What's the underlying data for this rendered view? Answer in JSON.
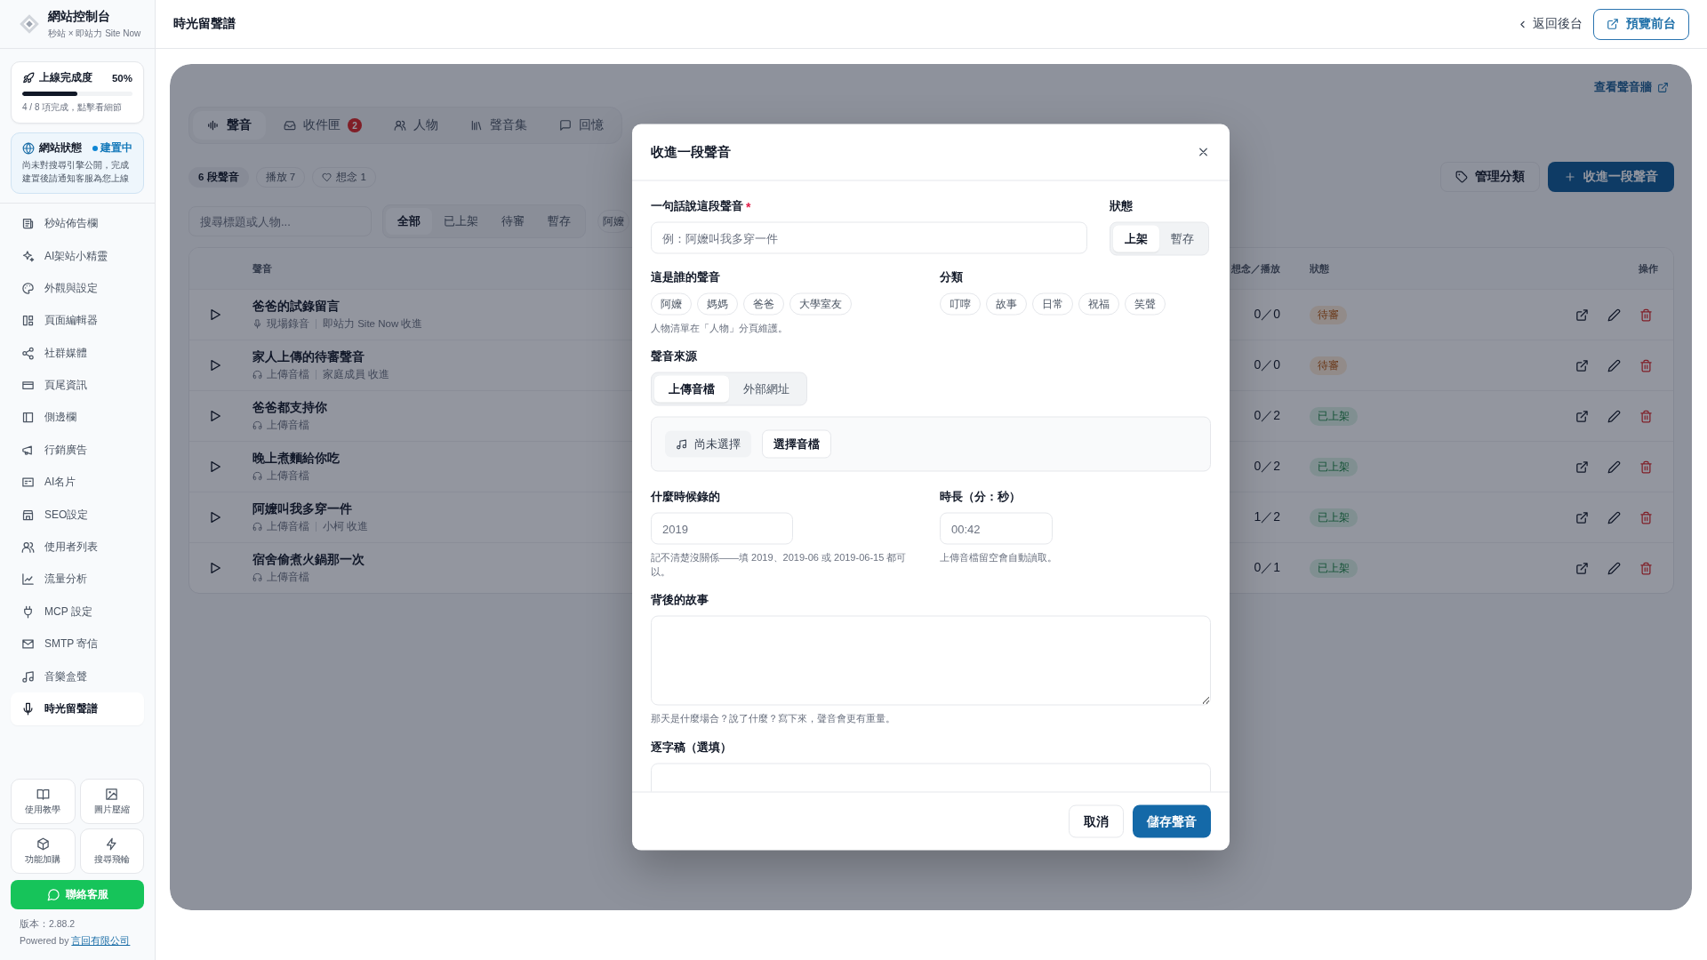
{
  "sidebar": {
    "brand": {
      "title": "網站控制台",
      "subtitle": "秒站 × 即站力 Site Now"
    },
    "progress_card": {
      "title": "上線完成度",
      "percent": "50%",
      "level": 0.5,
      "caption": "4 / 8 項完成，點擊看細節"
    },
    "status_card": {
      "title": "網站狀態",
      "status": "建置中",
      "description": "尚未對搜尋引擎公開，完成建置後請通知客服為您上線"
    },
    "items": [
      {
        "label": "秒站佈告欄",
        "selected": false
      },
      {
        "label": "AI架站小精靈",
        "selected": false
      },
      {
        "label": "外觀與設定",
        "selected": false
      },
      {
        "label": "頁面編輯器",
        "selected": false
      },
      {
        "label": "社群媒體",
        "selected": false
      },
      {
        "label": "頁尾資訊",
        "selected": false
      },
      {
        "label": "側邊欄",
        "selected": false
      },
      {
        "label": "行銷廣告",
        "selected": false
      },
      {
        "label": "AI名片",
        "selected": false
      },
      {
        "label": "SEO設定",
        "selected": false
      },
      {
        "label": "使用者列表",
        "selected": false
      },
      {
        "label": "流量分析",
        "selected": false
      },
      {
        "label": "MCP 設定",
        "selected": false
      },
      {
        "label": "SMTP 寄信",
        "selected": false
      },
      {
        "label": "音樂盒聲",
        "selected": false
      },
      {
        "label": "時光留聲譜",
        "selected": true
      }
    ],
    "tools": [
      {
        "label": "使用教學"
      },
      {
        "label": "圖片壓縮"
      },
      {
        "label": "功能加購"
      },
      {
        "label": "搜尋飛輪"
      }
    ],
    "contact_button": "聯絡客服",
    "version": "版本：2.88.2",
    "powered_by": {
      "text": "Powered by",
      "link": "言回有限公司"
    }
  },
  "header": {
    "title": "時光留聲譜",
    "back_link": "返回後台",
    "preview_button": "預覽前台"
  },
  "page": {
    "wall_link": "查看聲音牆",
    "tabs": [
      {
        "label": "聲音",
        "selected": true
      },
      {
        "label": "收件匣",
        "badge": "2",
        "selected": false
      },
      {
        "label": "人物",
        "selected": false
      },
      {
        "label": "聲音集",
        "selected": false
      },
      {
        "label": "回憶",
        "selected": false
      }
    ],
    "total": "6 段聲音",
    "plays": "播放 7",
    "likes": "想念 1",
    "manage_button": "管理分類",
    "add_button": "收進一段聲音",
    "search": {
      "placeholder": "搜尋標題或人物..."
    },
    "filters": [
      {
        "label": "全部",
        "selected": true
      },
      {
        "label": "已上架",
        "selected": false
      },
      {
        "label": "待審",
        "selected": false
      },
      {
        "label": "暫存",
        "selected": false
      }
    ],
    "person_filter": "阿嬤",
    "table": {
      "columns": {
        "title": "聲音",
        "counts": "想念／播放",
        "status": "狀態",
        "actions": "操作"
      },
      "rows": [
        {
          "title": "爸爸的試錄留言",
          "kind": "live",
          "source": "現場錄音",
          "contributor": "即站力 Site Now 收進",
          "counts": "0／0",
          "status": {
            "label": "待審",
            "kind": "pending"
          }
        },
        {
          "title": "家人上傳的待審聲音",
          "kind": "upload",
          "source": "上傳音檔",
          "contributor": "家庭成員 收進",
          "counts": "0／0",
          "status": {
            "label": "待審",
            "kind": "pending"
          }
        },
        {
          "title": "爸爸都支持你",
          "kind": "upload",
          "source": "上傳音檔",
          "counts": "0／2",
          "status": {
            "label": "已上架",
            "kind": "published"
          }
        },
        {
          "title": "晚上煮麵給你吃",
          "kind": "upload",
          "source": "上傳音檔",
          "counts": "0／2",
          "status": {
            "label": "已上架",
            "kind": "published"
          }
        },
        {
          "title": "阿嬤叫我多穿一件",
          "kind": "upload",
          "source": "上傳音檔",
          "contributor": "小柯 收進",
          "counts": "1／2",
          "status": {
            "label": "已上架",
            "kind": "published"
          }
        },
        {
          "title": "宿舍偷煮火鍋那一次",
          "kind": "upload",
          "source": "上傳音檔",
          "counts": "0／1",
          "status": {
            "label": "已上架",
            "kind": "published"
          }
        }
      ]
    }
  },
  "modal": {
    "title": "收進一段聲音",
    "summary": {
      "label": "一句話說這段聲音",
      "required_mark": "*",
      "placeholder": "例：阿嬤叫我多穿一件"
    },
    "status": {
      "label": "狀態",
      "options": [
        {
          "label": "上架",
          "selected": true
        },
        {
          "label": "暫存",
          "selected": false
        }
      ]
    },
    "people": {
      "label": "這是誰的聲音",
      "options": [
        {
          "label": "阿嬤",
          "selected": false
        },
        {
          "label": "媽媽",
          "selected": false
        },
        {
          "label": "爸爸",
          "selected": false
        },
        {
          "label": "大學室友",
          "selected": false
        }
      ],
      "hint": "人物清單在「人物」分頁維護。"
    },
    "category": {
      "label": "分類",
      "options": [
        {
          "label": "叮嚀",
          "selected": false
        },
        {
          "label": "故事",
          "selected": false
        },
        {
          "label": "日常",
          "selected": false
        },
        {
          "label": "祝福",
          "selected": false
        },
        {
          "label": "笑聲",
          "selected": false
        }
      ]
    },
    "source": {
      "label": "聲音來源",
      "options": [
        {
          "label": "上傳音檔",
          "selected": true
        },
        {
          "label": "外部網址",
          "selected": false
        }
      ]
    },
    "file": {
      "status": "尚未選擇",
      "button": "選擇音檔"
    },
    "recorded": {
      "label": "什麼時候錄的",
      "placeholder": "2019",
      "hint": "記不清楚沒關係——填 2019、2019-06 或 2019-06-15 都可以。"
    },
    "duration": {
      "label": "時長（分：秒）",
      "placeholder": "00:42",
      "hint": "上傳音檔留空會自動讀取。"
    },
    "story": {
      "label": "背後的故事",
      "hint": "那天是什麼場合？說了什麼？寫下來，聲音會更有重量。"
    },
    "transcript": {
      "label": "逐字稿（選填）"
    },
    "cancel_button": "取消",
    "save_button": "儲存聲音"
  }
}
